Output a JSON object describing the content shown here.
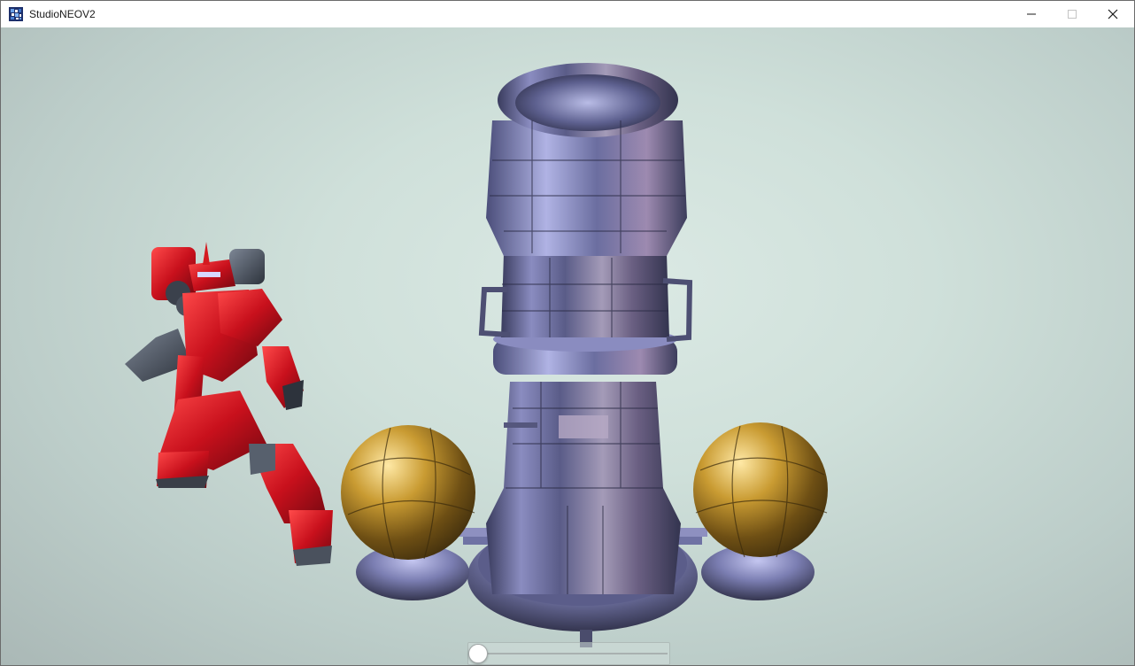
{
  "window": {
    "title": "StudioNEOV2",
    "icon": "studio-app-icon",
    "controls": {
      "minimize": "minimize-icon",
      "maximize": "maximize-icon",
      "close": "close-icon"
    }
  },
  "viewport": {
    "background_color": "#d4e4de",
    "objects": [
      {
        "name": "red-mech-robot",
        "color": "#c81a22"
      },
      {
        "name": "metal-tower",
        "color": "#7d7fb0"
      },
      {
        "name": "gold-sphere-left",
        "color": "#b08a2a"
      },
      {
        "name": "gold-sphere-right",
        "color": "#b08a2a"
      }
    ]
  },
  "timeline_slider": {
    "value": 0
  }
}
